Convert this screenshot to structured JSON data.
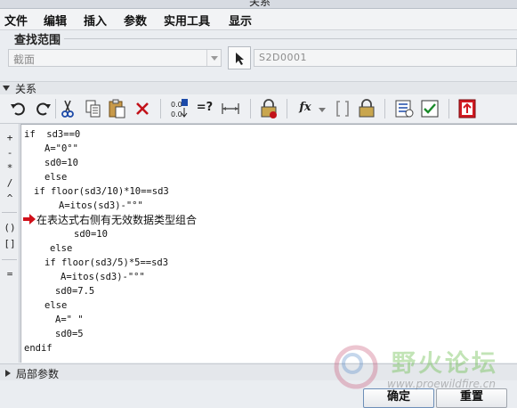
{
  "window": {
    "title": "关系"
  },
  "menu": [
    "文件",
    "编辑",
    "插入",
    "参数",
    "实用工具",
    "显示"
  ],
  "search": {
    "title": "查找范围",
    "scope_value": "截面",
    "model_value": "S2D0001"
  },
  "relations": {
    "title": "关系",
    "operators": [
      "+",
      "-",
      "*",
      "/",
      "^",
      "()",
      "[]",
      "="
    ],
    "code_lines": [
      "if  sd3==0",
      "A=\"0°\"",
      "sd0=10",
      "else",
      "if floor(sd3/10)*10==sd3",
      "A=itos(sd3)-\"°\"",
      "在表达式右侧有无效数据类型组合",
      "sd0=10",
      "else",
      "if floor(sd3/5)*5==sd3",
      "A=itos(sd3)-\"°\"",
      "sd0=7.5",
      "else",
      "A=\" \"",
      "sd0=5",
      "endif"
    ]
  },
  "toolbar": {
    "items": [
      "undo-icon",
      "redo-icon",
      "cut-icon",
      "copy-icon",
      "paste-icon",
      "delete-icon",
      "sort-icon",
      "evaluate-icon",
      "dimension-icon",
      "lock-icon",
      "function-icon",
      "bracket-icon",
      "parameter-lock-icon",
      "display-icon",
      "verify-icon",
      "export-icon"
    ],
    "evaluate_label": "=?",
    "function_label": "fx"
  },
  "local_params": {
    "title": "局部参数"
  },
  "buttons": {
    "ok": "确定",
    "reset": "重置"
  },
  "watermark": {
    "text": "野火论坛",
    "url": "www.proewildfire.cn"
  },
  "colors": {
    "error_marker": "#d0101a",
    "editor_bg": "#ffffff",
    "panel_bg": "#eaedf1"
  }
}
